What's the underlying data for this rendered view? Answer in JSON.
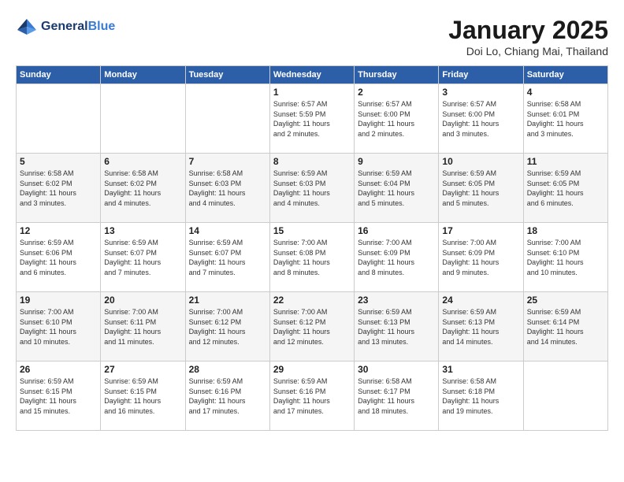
{
  "header": {
    "logo_line1": "General",
    "logo_line2": "Blue",
    "month_year": "January 2025",
    "location": "Doi Lo, Chiang Mai, Thailand"
  },
  "weekdays": [
    "Sunday",
    "Monday",
    "Tuesday",
    "Wednesday",
    "Thursday",
    "Friday",
    "Saturday"
  ],
  "weeks": [
    [
      {
        "day": "",
        "info": ""
      },
      {
        "day": "",
        "info": ""
      },
      {
        "day": "",
        "info": ""
      },
      {
        "day": "1",
        "info": "Sunrise: 6:57 AM\nSunset: 5:59 PM\nDaylight: 11 hours\nand 2 minutes."
      },
      {
        "day": "2",
        "info": "Sunrise: 6:57 AM\nSunset: 6:00 PM\nDaylight: 11 hours\nand 2 minutes."
      },
      {
        "day": "3",
        "info": "Sunrise: 6:57 AM\nSunset: 6:00 PM\nDaylight: 11 hours\nand 3 minutes."
      },
      {
        "day": "4",
        "info": "Sunrise: 6:58 AM\nSunset: 6:01 PM\nDaylight: 11 hours\nand 3 minutes."
      }
    ],
    [
      {
        "day": "5",
        "info": "Sunrise: 6:58 AM\nSunset: 6:02 PM\nDaylight: 11 hours\nand 3 minutes."
      },
      {
        "day": "6",
        "info": "Sunrise: 6:58 AM\nSunset: 6:02 PM\nDaylight: 11 hours\nand 4 minutes."
      },
      {
        "day": "7",
        "info": "Sunrise: 6:58 AM\nSunset: 6:03 PM\nDaylight: 11 hours\nand 4 minutes."
      },
      {
        "day": "8",
        "info": "Sunrise: 6:59 AM\nSunset: 6:03 PM\nDaylight: 11 hours\nand 4 minutes."
      },
      {
        "day": "9",
        "info": "Sunrise: 6:59 AM\nSunset: 6:04 PM\nDaylight: 11 hours\nand 5 minutes."
      },
      {
        "day": "10",
        "info": "Sunrise: 6:59 AM\nSunset: 6:05 PM\nDaylight: 11 hours\nand 5 minutes."
      },
      {
        "day": "11",
        "info": "Sunrise: 6:59 AM\nSunset: 6:05 PM\nDaylight: 11 hours\nand 6 minutes."
      }
    ],
    [
      {
        "day": "12",
        "info": "Sunrise: 6:59 AM\nSunset: 6:06 PM\nDaylight: 11 hours\nand 6 minutes."
      },
      {
        "day": "13",
        "info": "Sunrise: 6:59 AM\nSunset: 6:07 PM\nDaylight: 11 hours\nand 7 minutes."
      },
      {
        "day": "14",
        "info": "Sunrise: 6:59 AM\nSunset: 6:07 PM\nDaylight: 11 hours\nand 7 minutes."
      },
      {
        "day": "15",
        "info": "Sunrise: 7:00 AM\nSunset: 6:08 PM\nDaylight: 11 hours\nand 8 minutes."
      },
      {
        "day": "16",
        "info": "Sunrise: 7:00 AM\nSunset: 6:09 PM\nDaylight: 11 hours\nand 8 minutes."
      },
      {
        "day": "17",
        "info": "Sunrise: 7:00 AM\nSunset: 6:09 PM\nDaylight: 11 hours\nand 9 minutes."
      },
      {
        "day": "18",
        "info": "Sunrise: 7:00 AM\nSunset: 6:10 PM\nDaylight: 11 hours\nand 10 minutes."
      }
    ],
    [
      {
        "day": "19",
        "info": "Sunrise: 7:00 AM\nSunset: 6:10 PM\nDaylight: 11 hours\nand 10 minutes."
      },
      {
        "day": "20",
        "info": "Sunrise: 7:00 AM\nSunset: 6:11 PM\nDaylight: 11 hours\nand 11 minutes."
      },
      {
        "day": "21",
        "info": "Sunrise: 7:00 AM\nSunset: 6:12 PM\nDaylight: 11 hours\nand 12 minutes."
      },
      {
        "day": "22",
        "info": "Sunrise: 7:00 AM\nSunset: 6:12 PM\nDaylight: 11 hours\nand 12 minutes."
      },
      {
        "day": "23",
        "info": "Sunrise: 6:59 AM\nSunset: 6:13 PM\nDaylight: 11 hours\nand 13 minutes."
      },
      {
        "day": "24",
        "info": "Sunrise: 6:59 AM\nSunset: 6:13 PM\nDaylight: 11 hours\nand 14 minutes."
      },
      {
        "day": "25",
        "info": "Sunrise: 6:59 AM\nSunset: 6:14 PM\nDaylight: 11 hours\nand 14 minutes."
      }
    ],
    [
      {
        "day": "26",
        "info": "Sunrise: 6:59 AM\nSunset: 6:15 PM\nDaylight: 11 hours\nand 15 minutes."
      },
      {
        "day": "27",
        "info": "Sunrise: 6:59 AM\nSunset: 6:15 PM\nDaylight: 11 hours\nand 16 minutes."
      },
      {
        "day": "28",
        "info": "Sunrise: 6:59 AM\nSunset: 6:16 PM\nDaylight: 11 hours\nand 17 minutes."
      },
      {
        "day": "29",
        "info": "Sunrise: 6:59 AM\nSunset: 6:16 PM\nDaylight: 11 hours\nand 17 minutes."
      },
      {
        "day": "30",
        "info": "Sunrise: 6:58 AM\nSunset: 6:17 PM\nDaylight: 11 hours\nand 18 minutes."
      },
      {
        "day": "31",
        "info": "Sunrise: 6:58 AM\nSunset: 6:18 PM\nDaylight: 11 hours\nand 19 minutes."
      },
      {
        "day": "",
        "info": ""
      }
    ]
  ]
}
